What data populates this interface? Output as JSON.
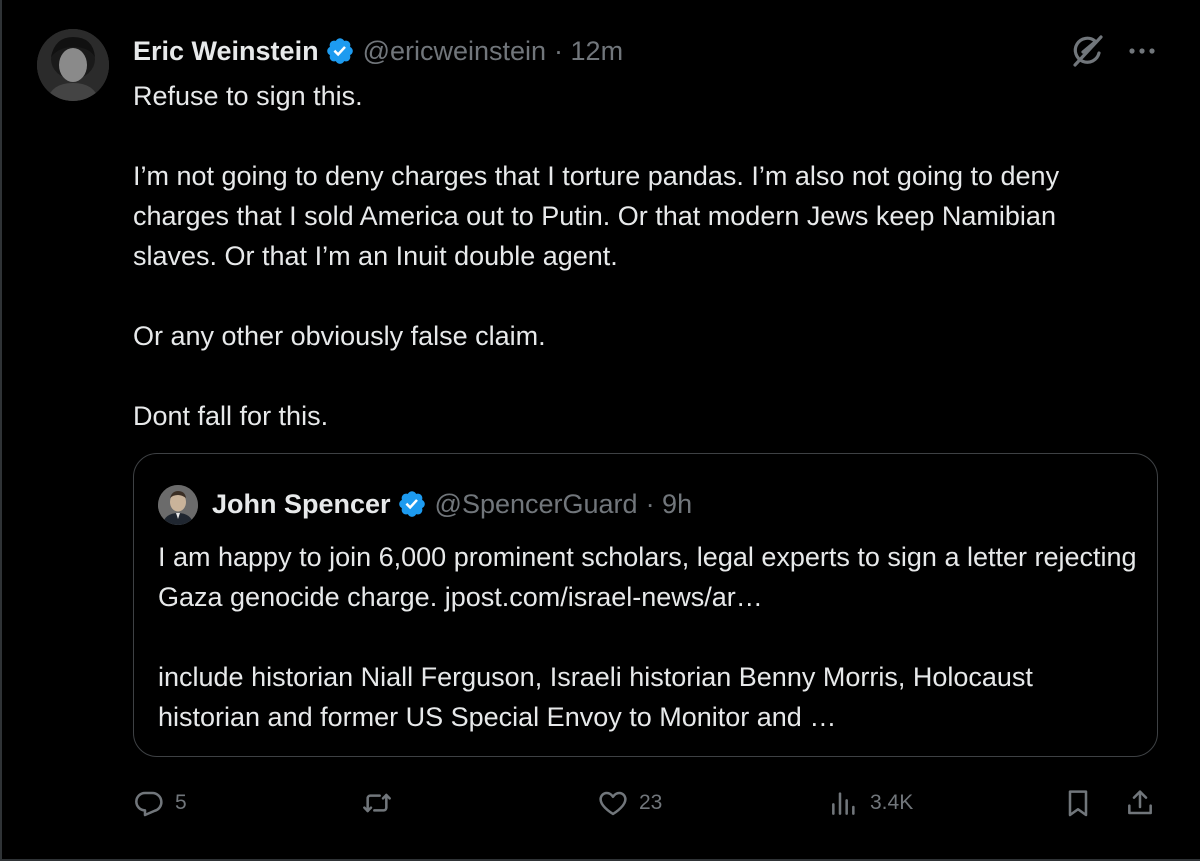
{
  "post": {
    "author_name": "Eric Weinstein",
    "handle": "@ericweinstein",
    "time": "· 12m",
    "paragraphs": [
      "Refuse to sign this.",
      "I’m not going to deny charges that I torture pandas. I’m also not going to deny charges that I sold America out to Putin. Or that modern Jews keep Namibian slaves. Or that I’m an Inuit double agent.",
      "Or any other obviously false claim.",
      "Dont fall for this."
    ]
  },
  "quoted_post": {
    "author_name": "John Spencer",
    "handle": "@SpencerGuard",
    "time": "· 9h",
    "paragraphs": [
      "I am happy to join 6,000 prominent scholars, legal experts to sign a letter rejecting Gaza genocide charge. jpost.com/israel-news/ar…",
      "include historian Niall Ferguson, Israeli historian Benny Morris, Holocaust historian and former US Special Envoy to Monitor and …"
    ]
  },
  "actions": {
    "replies": "5",
    "reposts": "",
    "likes": "23",
    "views": "3.4K"
  },
  "colors": {
    "background": "#000000",
    "text": "#e7e9ea",
    "muted": "#71767b",
    "verified_blue": "#1d9bf0",
    "border": "#3e4144"
  },
  "icons": {
    "verified": "verified-badge-icon",
    "grok": "grok-icon",
    "more": "more-options-icon",
    "reply": "reply-icon",
    "repost": "repost-icon",
    "like": "heart-icon",
    "views": "views-chart-icon",
    "bookmark": "bookmark-icon",
    "share": "share-icon"
  }
}
